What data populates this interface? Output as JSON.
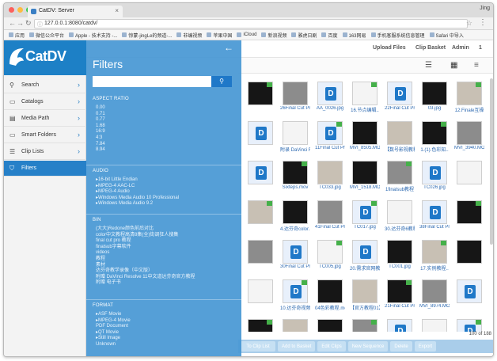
{
  "browser": {
    "tab_title": "CatDV: Server",
    "url": "127.0.0.1:8080/catdv/",
    "user_chip": "Jing",
    "bookmarks": [
      "应用",
      "微信公众平台",
      "Apple - 技术支持 -...",
      "惊蒙-jingLe的频道-...",
      "非编视频",
      "苹果中国",
      "iCloud",
      "新浪视频",
      "雅虎日剧",
      "百度",
      "163网易",
      "手机客服系统信息管理",
      "Safari 中导入"
    ]
  },
  "topnav": {
    "upload_label": "Upload Files",
    "basket_label": "Clip Basket",
    "admin_label": "Admin",
    "user_label": "1"
  },
  "sidebar": {
    "logo_text": "CatDV",
    "items": [
      {
        "label": "Search",
        "icon": "search-icon"
      },
      {
        "label": "Catalogs",
        "icon": "folder-icon"
      },
      {
        "label": "Media Path",
        "icon": "media-icon"
      },
      {
        "label": "Smart Folders",
        "icon": "folder-icon"
      },
      {
        "label": "Clip Lists",
        "icon": "list-icon"
      },
      {
        "label": "Filters",
        "icon": "filter-icon"
      }
    ]
  },
  "filters": {
    "title": "Filters",
    "search_placeholder": "",
    "sections": [
      {
        "title": "ASPECT RATIO",
        "items": [
          "0.00",
          "0.71",
          "0.77",
          "1.68",
          "16:9",
          "4:3",
          "7.84",
          "8.94"
        ]
      },
      {
        "title": "AUDIO",
        "items": [
          "▸16-bit Little Endian",
          "▸MPEG-4 AAC-LC",
          "▸MPEG-4 Audio",
          "▸Windows Media Audio 10 Professional",
          "▸Windows Media Audio 9.2"
        ]
      },
      {
        "title": "BIN",
        "items": [
          "(大大)Redone颜色前后对比",
          "color中文教程高清8集(全)街调狂人搜集",
          "final cut pro 教程",
          "finalsub字幕软件",
          "videos",
          "教程",
          "素材",
          "达芬奇教学录像（中文版）",
          "附赠 DaVinci Resolve 11中文道达芬奇官方教程",
          "附赠 电子书"
        ]
      },
      {
        "title": "FORMAT",
        "items": [
          "▸ASF Movie",
          "▸MPEG-4 Movie",
          "PDF Document",
          "▸QT Movie",
          "▸Still Image",
          "Unknown"
        ]
      }
    ]
  },
  "grid": {
    "rows": [
      [
        "",
        "26Final Cut Pr",
        "AA_0026.jpg",
        "16.节点编辑..",
        "22Final Cut Pr",
        "03.jpg",
        "12.Finale互操"
      ],
      [
        "",
        "附录 DaVinci R",
        "11Final Cut Pr",
        "MVI_8505.MO",
        "【数号影视教程",
        "1.(1).色彩知..",
        "MVI_3940.MO"
      ],
      [
        "",
        "Sixteps.mov",
        "TC033.jpg",
        "MVI_1518.MO",
        "1finalsub教程",
        "TC026.jpg",
        ""
      ],
      [
        "",
        "4.达芬奇color..",
        "41Final Cut Pr",
        "TC017.jpg",
        "30.达芬奇6教程",
        "38Final Cut Pr",
        ""
      ],
      [
        "",
        "30Final Cut Pr",
        "TC005.jpg",
        "20.需求官网教",
        "TC001.jpg",
        "17.实例教程..",
        ""
      ],
      [
        "",
        "10.达芬奇视频",
        "04色彩教程.mo",
        "【官方教程01】",
        "21Final Cut Pr",
        "MVI_8974.MO",
        ""
      ],
      [
        "",
        "",
        "",
        "",
        "",
        "",
        ""
      ]
    ]
  },
  "count_label": "100 of 188",
  "bottom_buttons": [
    "To Clip List",
    "Add to Basket",
    "Edit Clips",
    "New Sequence",
    "Delete",
    "Export"
  ],
  "colors": {
    "brand_blue": "#1d80c6",
    "panel_blue": "#4898d4",
    "active_blue": "#2680c8"
  }
}
